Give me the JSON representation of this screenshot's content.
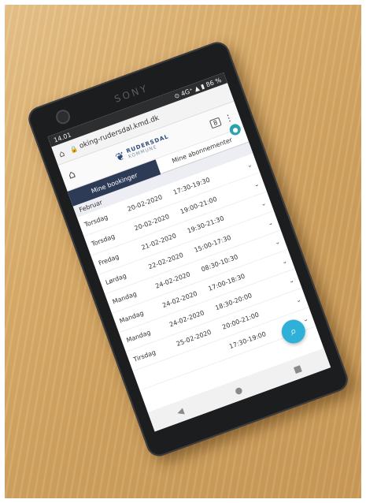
{
  "status_bar": {
    "time": "14.01",
    "indicators": "⊙ 4G⁺ ▲ ▮ 86 %"
  },
  "browser": {
    "url": "oking-rudersdal.kmd.dk",
    "tab_count": "8"
  },
  "brand": {
    "name": "RUDERSDAL",
    "sub": "KOMMUNE"
  },
  "device": {
    "brand": "SONY"
  },
  "tabs": [
    {
      "label": "Mine bookinger",
      "active": true
    },
    {
      "label": "Mine abonnementer",
      "active": false
    }
  ],
  "month": "Februar",
  "bookings": [
    {
      "day": "Torsdag",
      "date": "20-02-2020",
      "time": "17:30-19:30"
    },
    {
      "day": "Torsdag",
      "date": "20-02-2020",
      "time": "19:00-21:00"
    },
    {
      "day": "Fredag",
      "date": "21-02-2020",
      "time": "19:30-21:30"
    },
    {
      "day": "Lørdag",
      "date": "22-02-2020",
      "time": "15:00-17:30"
    },
    {
      "day": "Mandag",
      "date": "24-02-2020",
      "time": "08:30-10:30"
    },
    {
      "day": "Mandag",
      "date": "24-02-2020",
      "time": "17:00-18:30"
    },
    {
      "day": "Mandag",
      "date": "24-02-2020",
      "time": "18:30-20:00"
    },
    {
      "day": "Tirsdag",
      "date": "25-02-2020",
      "time": "20:00-21:00"
    },
    {
      "day": "",
      "date": "",
      "time": "17:30-19:00"
    }
  ],
  "icons": {
    "home": "home-icon",
    "search": "search-icon",
    "user": "user-icon",
    "chevron": "chevron-down-icon"
  }
}
